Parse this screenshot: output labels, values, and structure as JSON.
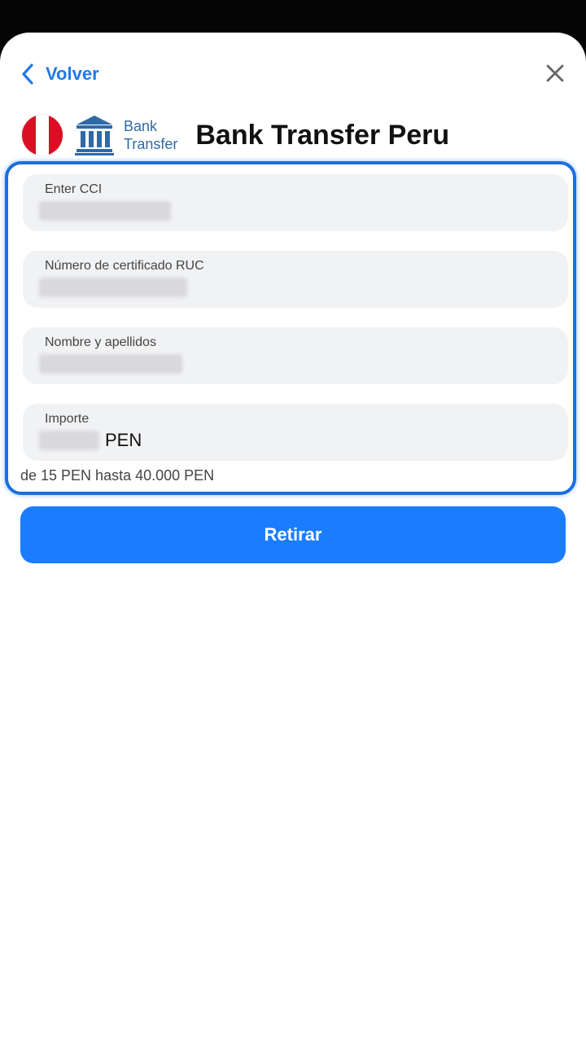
{
  "nav": {
    "back_label": "Volver"
  },
  "header": {
    "title": "Bank Transfer Peru",
    "logo_line1": "Bank",
    "logo_line2": "Transfer"
  },
  "form": {
    "fields": [
      {
        "label": "Enter CCI",
        "value": ""
      },
      {
        "label": "Número de certificado RUC",
        "value": ""
      },
      {
        "label": "Nombre y apellidos",
        "value": ""
      },
      {
        "label": "Importe",
        "value": "",
        "currency": "PEN"
      }
    ],
    "limits": "de 15 PEN hasta 40.000 PEN"
  },
  "actions": {
    "submit_label": "Retirar"
  },
  "colors": {
    "accent": "#1a7dff",
    "link": "#1f7ae8",
    "flag_red": "#d91023"
  },
  "icons": [
    "back-chevron-icon",
    "close-icon",
    "peru-flag-icon",
    "bank-building-icon"
  ]
}
